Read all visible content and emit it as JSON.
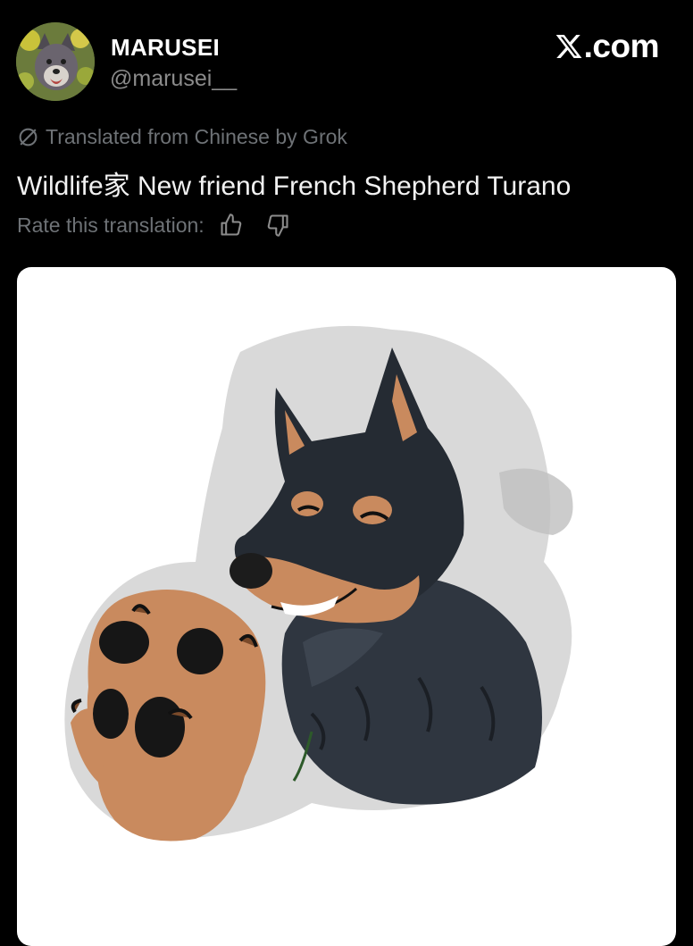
{
  "user": {
    "name": "MARUSEI",
    "handle": "@marusei__"
  },
  "site": {
    "logo_text": ".com"
  },
  "post": {
    "translated_label": "Translated from Chinese by Grok",
    "text": "Wildlife家 New friend French Shepherd Turano",
    "rate_label": "Rate this translation:"
  },
  "icons": {
    "x_logo": "x-logo-icon",
    "translate": "translate-icon",
    "thumbs_up": "thumbs-up-icon",
    "thumbs_down": "thumbs-down-icon"
  },
  "colors": {
    "background": "#000000",
    "muted_text": "#6e7276",
    "handle_text": "#8b8b8b",
    "card": "#ffffff"
  }
}
